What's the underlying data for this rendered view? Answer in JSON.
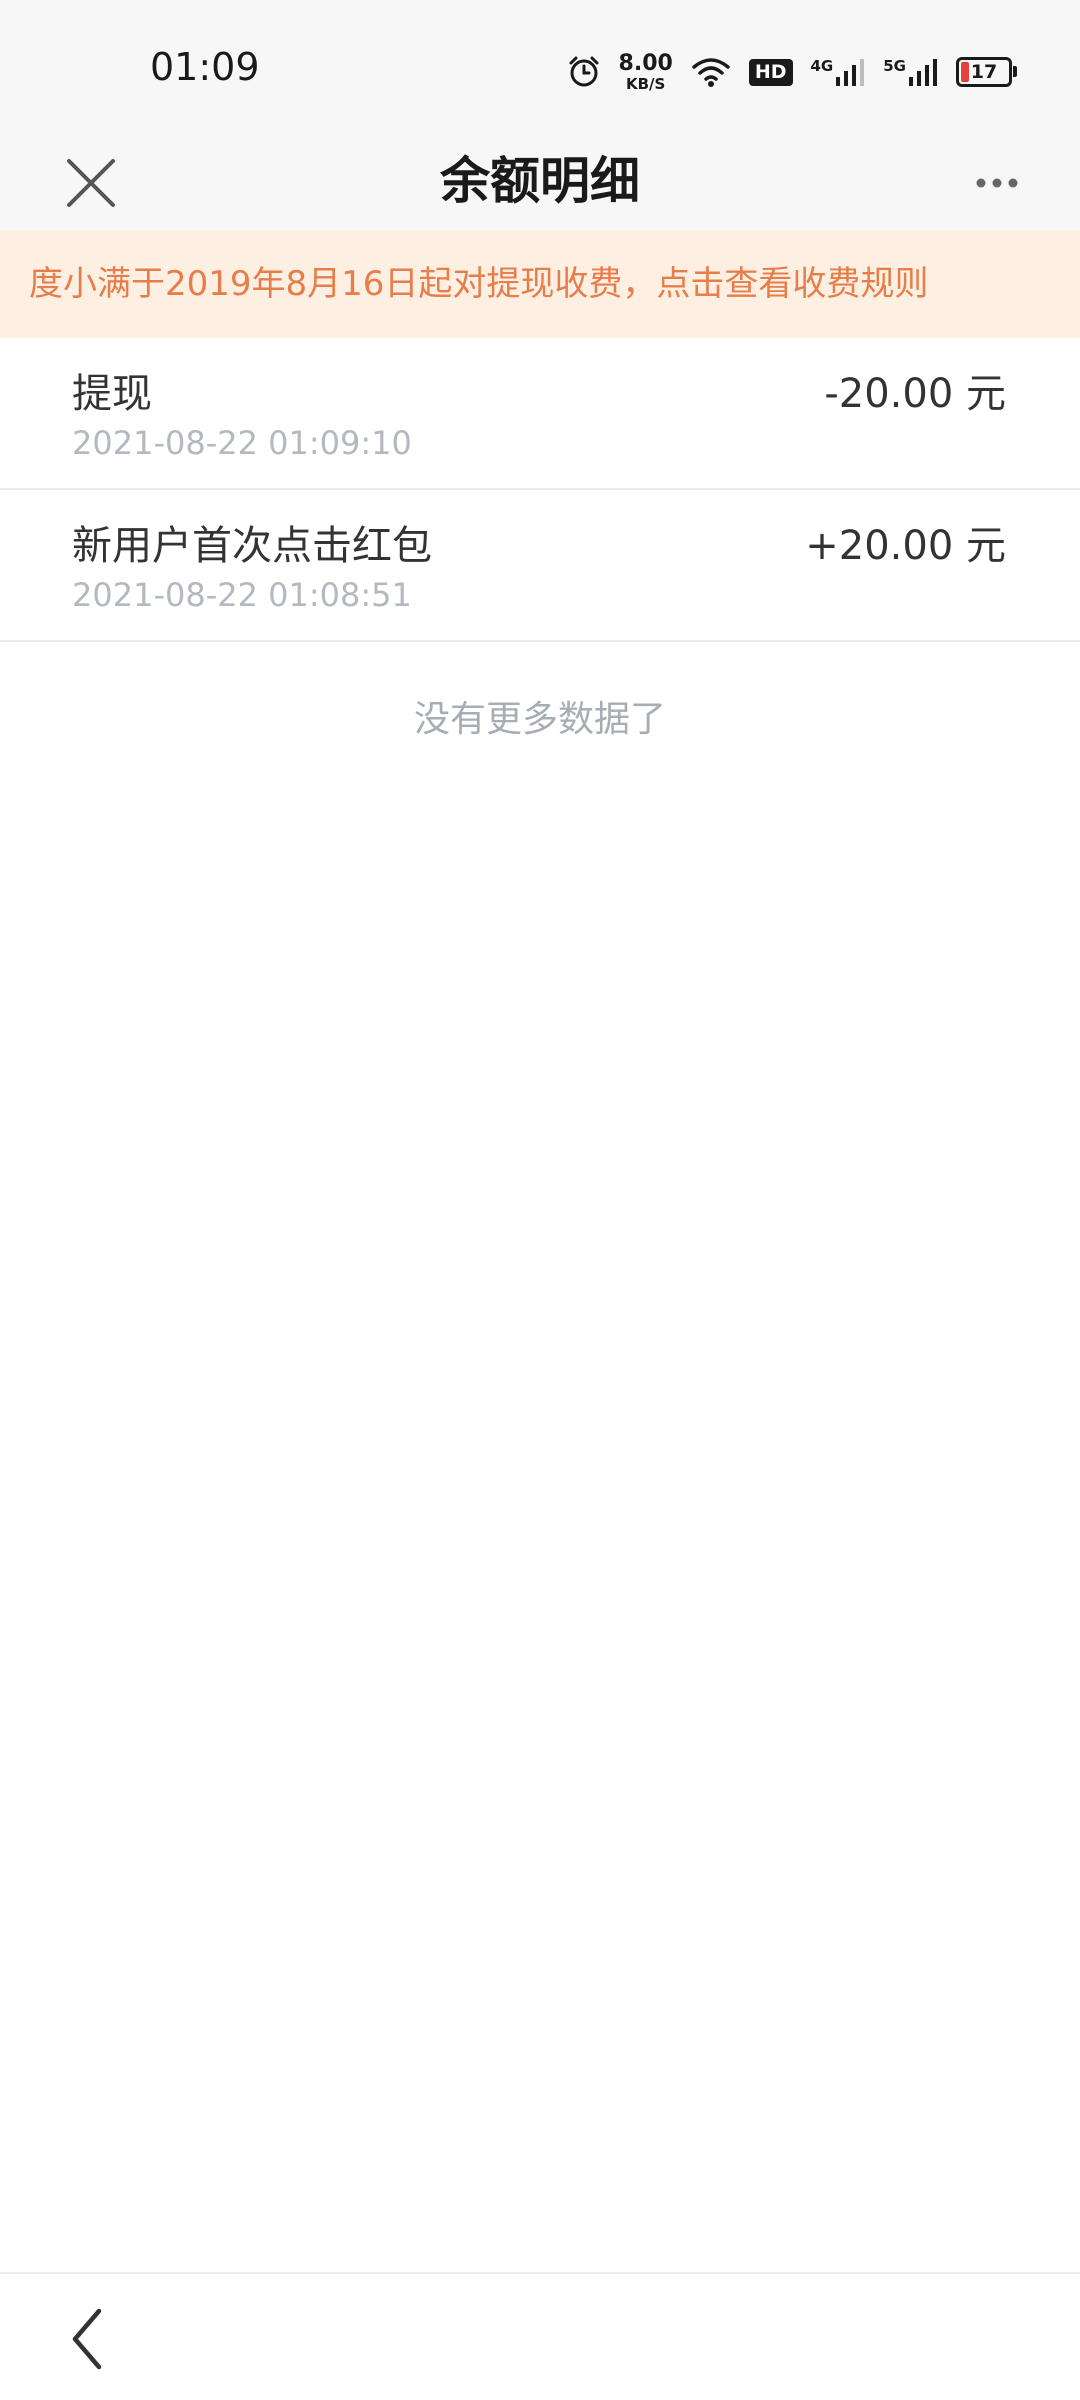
{
  "status_bar": {
    "time": "01:09",
    "net_speed_value": "8.00",
    "net_speed_unit": "KB/S",
    "hd_label": "HD",
    "sim1_label": "4G",
    "sim2_label": "5G",
    "battery_level": "17",
    "battery_color": "#e8413a",
    "icons": [
      "alarm-icon",
      "wifi-icon",
      "signal-icon",
      "battery-icon"
    ]
  },
  "header": {
    "title": "余额明细",
    "close_icon": "close-icon",
    "more_icon": "more-dots-icon"
  },
  "notice": {
    "text": "度小满于2019年8月16日起对提现收费，点击查看收费规则",
    "text_color": "#e77d4a",
    "background": "#fdf0e3"
  },
  "records": [
    {
      "title": "提现",
      "time": "2021-08-22 01:09:10",
      "amount": "-20.00 元"
    },
    {
      "title": "新用户首次点击红包",
      "time": "2021-08-22 01:08:51",
      "amount": "+20.00 元"
    }
  ],
  "list_footer": "没有更多数据了",
  "bottom_nav": {
    "back_icon": "chevron-left-icon"
  }
}
